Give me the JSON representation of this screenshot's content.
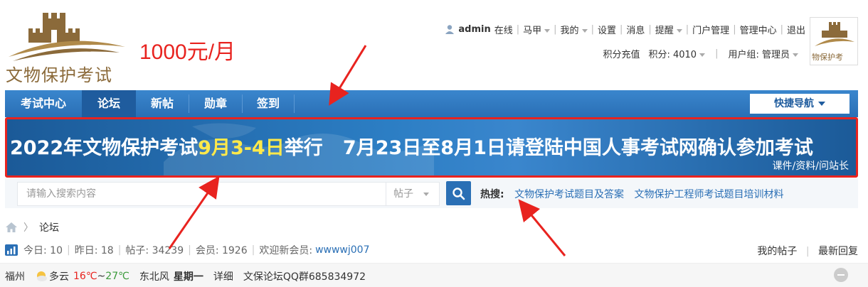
{
  "header": {
    "logo_text": "文物保护考试",
    "price_text": "1000元/月",
    "avatar_text": "物保护考",
    "user": {
      "name": "admin",
      "status": "在线"
    },
    "top_links": [
      {
        "label": "马甲",
        "dropdown": true
      },
      {
        "label": "我的",
        "dropdown": true
      },
      {
        "label": "设置",
        "dropdown": false
      },
      {
        "label": "消息",
        "dropdown": false
      },
      {
        "label": "提醒",
        "dropdown": true
      },
      {
        "label": "门户管理",
        "dropdown": false
      },
      {
        "label": "管理中心",
        "dropdown": false
      },
      {
        "label": "退出",
        "dropdown": false
      }
    ],
    "second_row": {
      "recharge": "积分充值",
      "points": "积分: 4010",
      "user_group": "用户组: 管理员"
    }
  },
  "nav": {
    "items": [
      "考试中心",
      "论坛",
      "新帖",
      "勋章",
      "签到"
    ],
    "active_index": 1,
    "quick_nav": "快捷导航"
  },
  "banner": {
    "text_before": "2022年文物保护考试",
    "text_highlight": "9月3-4日",
    "text_after": "举行   7月23日至8月1日请登陆中国人事考试网确认参加考试",
    "sub": "课件/资料/问站长"
  },
  "search": {
    "placeholder": "请输入搜索内容",
    "type": "帖子",
    "hot_label": "热搜:",
    "hot_keywords": [
      "文物保护考试题目及答案",
      "文物保护工程师考试题目培训材料"
    ]
  },
  "breadcrumb": {
    "current": "论坛"
  },
  "stats": {
    "today": "今日: 10",
    "yesterday": "昨日: 18",
    "posts": "帖子: 34239",
    "members": "会员: 1926",
    "welcome": "欢迎新会员:",
    "new_member": "wwwwj007",
    "my_posts": "我的帖子",
    "latest_reply": "最新回复"
  },
  "weather": {
    "city": "福州",
    "condition": "多云",
    "temp_low": "16℃",
    "tilde": "~",
    "temp_high": "27℃",
    "wind": "东北风",
    "day": "星期一",
    "detail": "详细",
    "qq_group": "文保论坛QQ群685834972"
  },
  "colors": {
    "primary": "#2a6fb5",
    "active_nav": "#1f5c9e",
    "accent_red": "#e8231f",
    "highlight_yellow": "#ffe94a",
    "logo_brown": "#8b6a3a"
  }
}
